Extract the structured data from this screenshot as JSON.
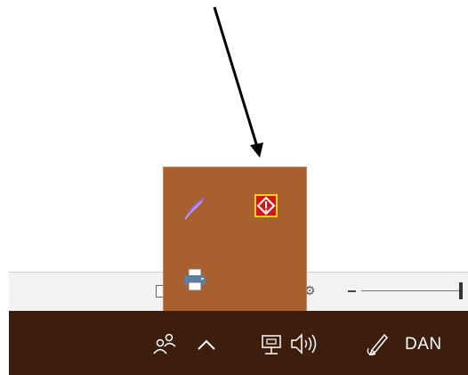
{
  "taskbar": {
    "icons": [
      {
        "name": "people-icon"
      },
      {
        "name": "chevron-up-icon"
      },
      {
        "name": "network-icon"
      },
      {
        "name": "volume-icon"
      },
      {
        "name": "pen-icon"
      }
    ],
    "language_label": "DAN",
    "background_color": "#3d1e0d"
  },
  "flyout": {
    "background_color": "#a8602e",
    "icons": [
      {
        "name": "feather-icon",
        "color": "#9a6ad6"
      },
      {
        "name": "red-diamond-app-icon",
        "color": "#d01818"
      },
      {
        "name": "printer-icon",
        "color": "#5a7fa0"
      }
    ]
  },
  "annotation": {
    "type": "arrow",
    "color": "#000000"
  }
}
